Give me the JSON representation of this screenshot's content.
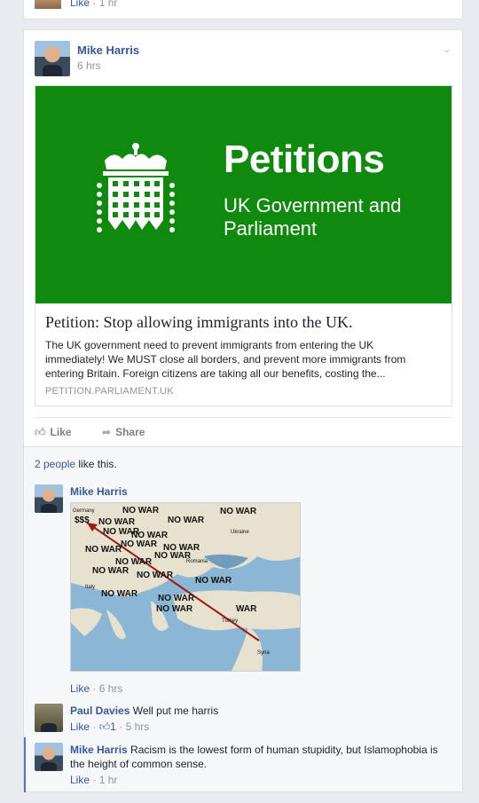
{
  "prev_post": {
    "like_label": "Like",
    "time": "1 hr"
  },
  "post": {
    "author": "Mike Harris",
    "time": "6 hrs",
    "link": {
      "banner_title": "Petitions",
      "banner_subtitle": "UK Government and Parliament",
      "title": "Petition: Stop allowing immigrants into the UK.",
      "description": "The UK government need to prevent immigrants from entering the UK immediately! We MUST close all borders, and prevent more immigrants from entering Britain. Foreign citizens are taking all our benefits, costing the...",
      "source": "PETITION.PARLIAMENT.UK"
    },
    "actions": {
      "like": "Like",
      "share": "Share"
    },
    "likes": {
      "count_link": "2 people",
      "suffix": " like this."
    }
  },
  "map": {
    "labels": [
      "$$$",
      "NO WAR",
      "NO WAR",
      "NO WAR",
      "NO WAR",
      "NO WAR",
      "NO WAR",
      "NO WAR",
      "NO WAR",
      "NO WAR",
      "NO WAR",
      "NO WAR",
      "NO WAR",
      "NO WAR",
      "NO WAR",
      "NO WAR",
      "NO WAR",
      "NO WAR",
      "WAR"
    ],
    "places": [
      "Germany",
      "Ukraine",
      "Romania",
      "Turkey",
      "Italy",
      "Syria"
    ]
  },
  "comments": [
    {
      "author": "Mike Harris",
      "text": "",
      "like": "Like",
      "time": "6 hrs"
    },
    {
      "author": "Paul Davies",
      "text": "Well put me harris",
      "like": "Like",
      "like_count": "1",
      "time": "5 hrs"
    },
    {
      "author": "Mike Harris",
      "text": "Racism is the lowest form of human stupidity, but Islamophobia is the height of common sense.",
      "like": "Like",
      "time": "1 hr"
    }
  ],
  "colors": {
    "link": "#365899",
    "banner_green": "#0f8a0f",
    "reply_accent": "#4a76d0"
  }
}
